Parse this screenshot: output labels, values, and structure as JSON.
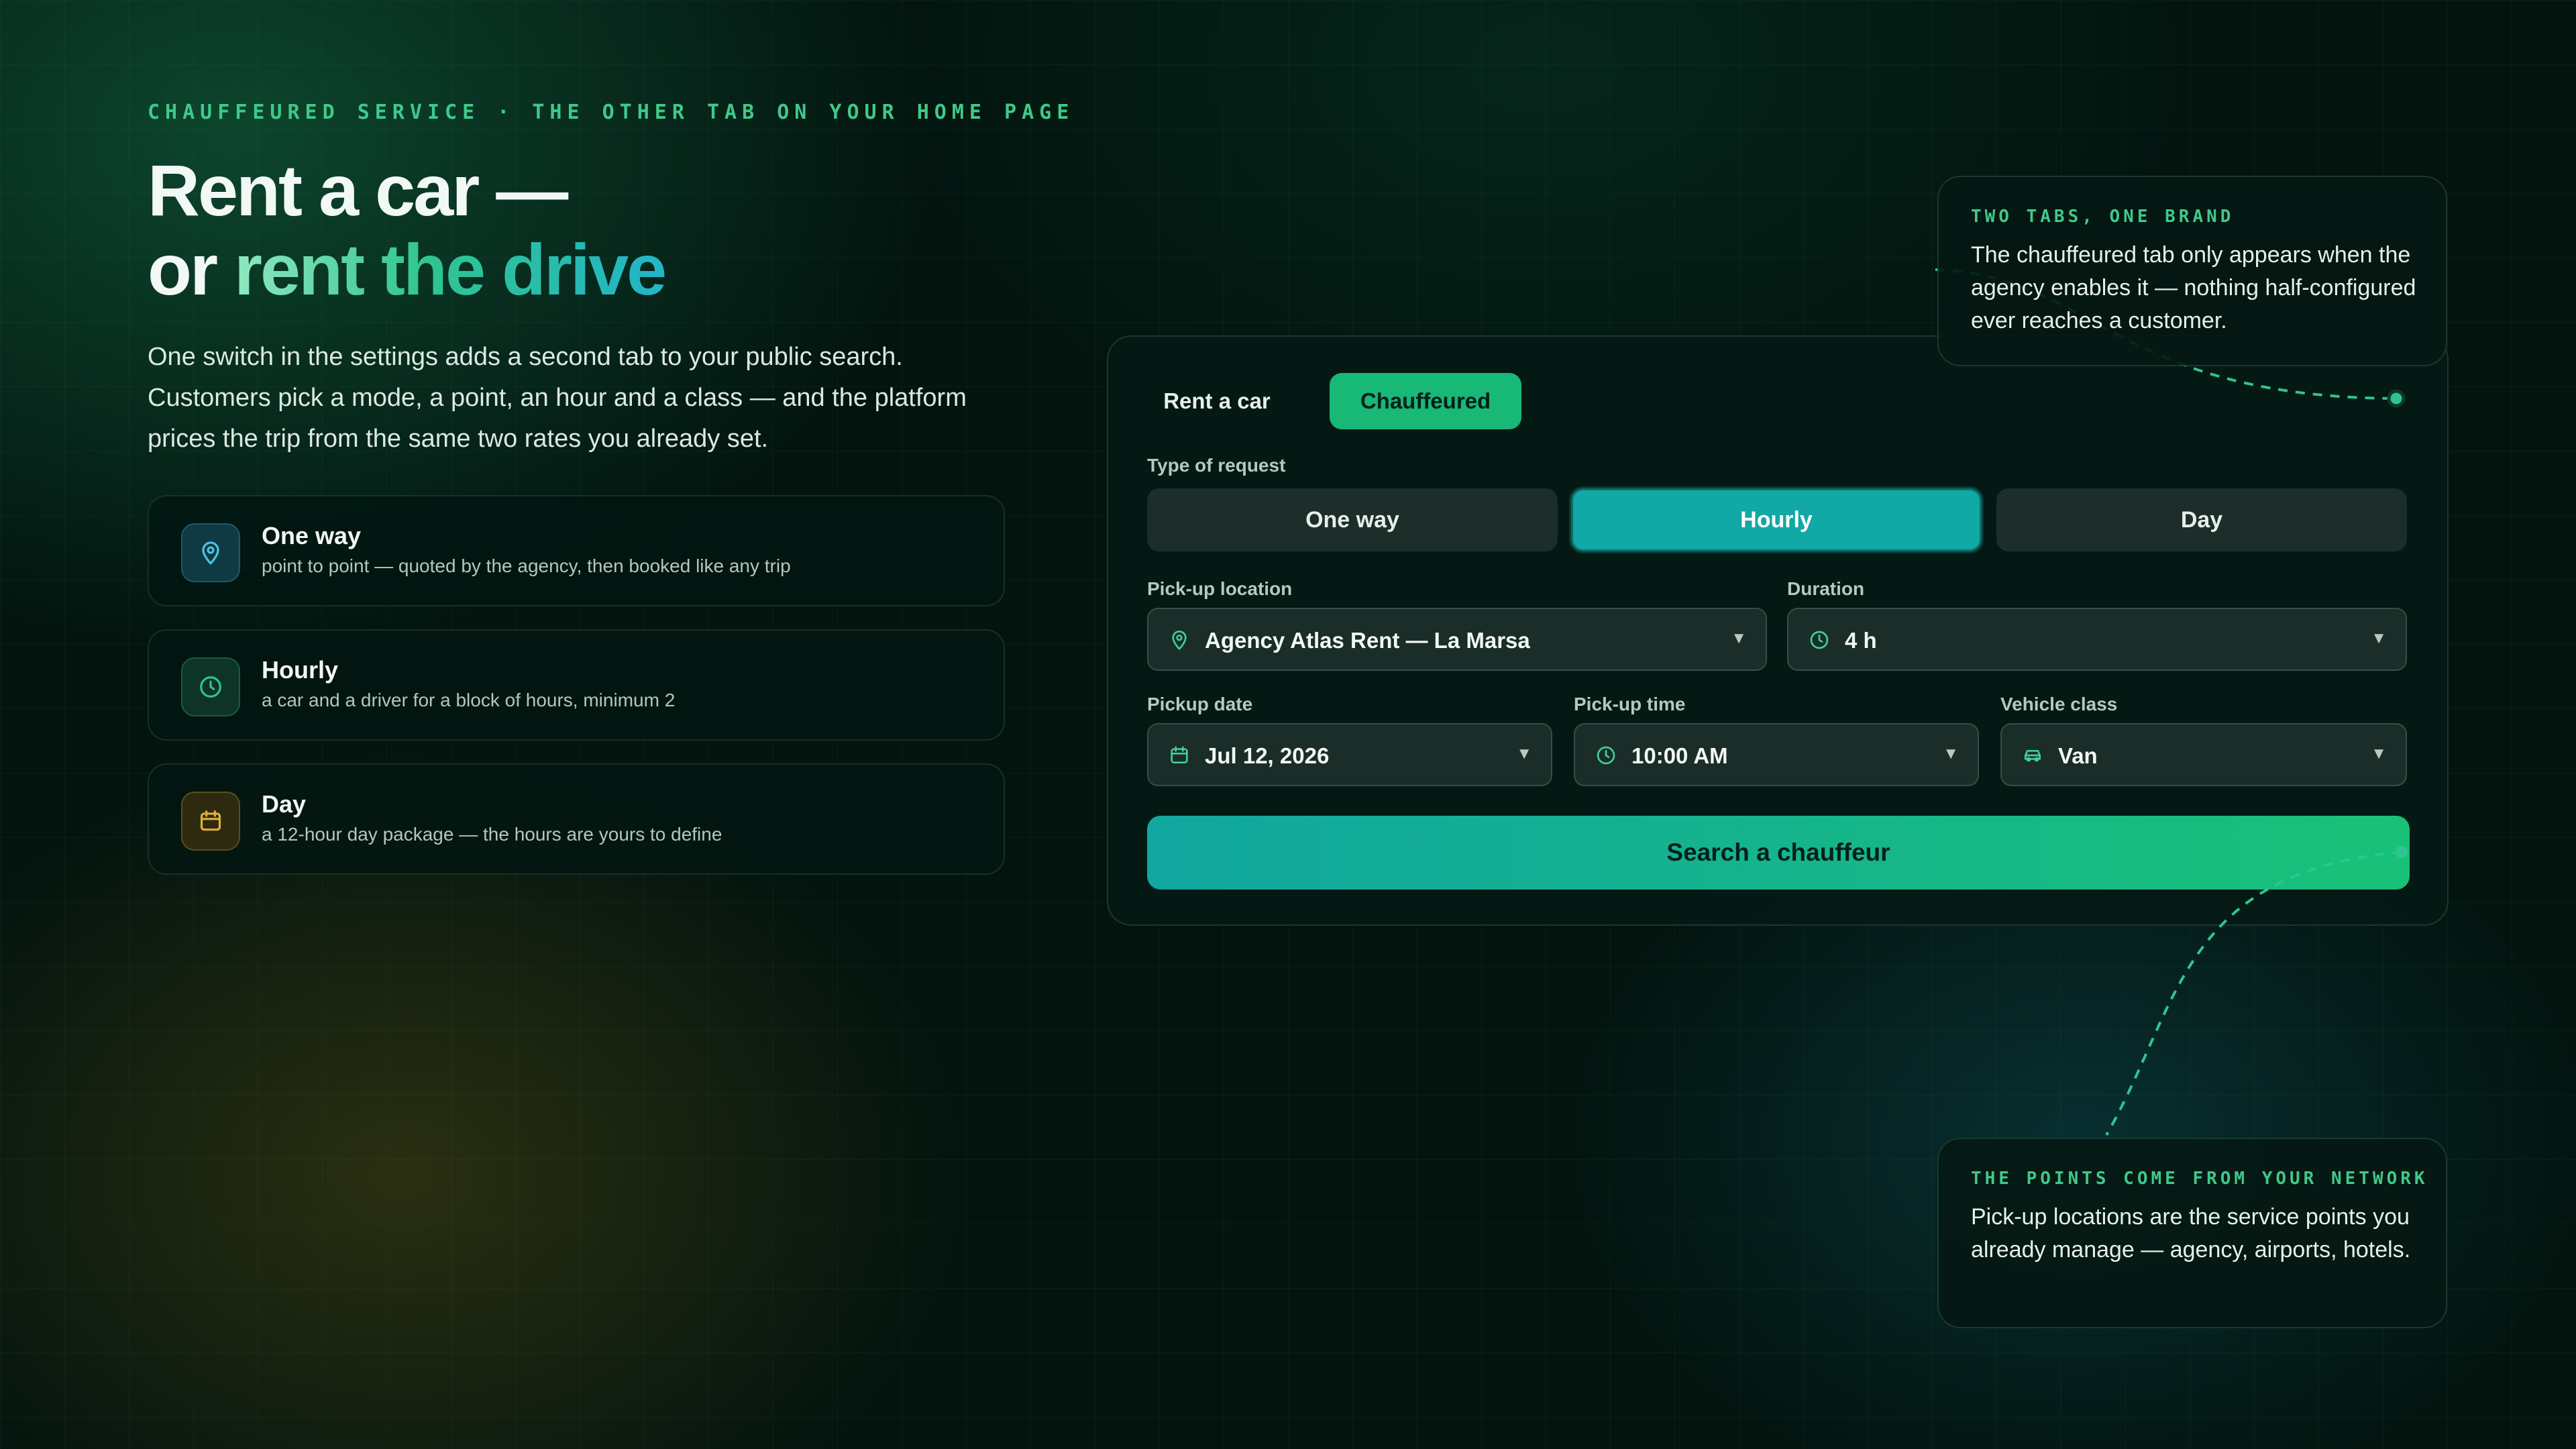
{
  "eyebrow": "CHAUFFEURED SERVICE · THE OTHER TAB ON YOUR HOME PAGE",
  "headline": {
    "line1": "Rent a car —",
    "line2_prefix": "or",
    "line2_accent": "rent the drive"
  },
  "lede": "One switch in the settings adds a second tab to your public search. Customers pick a mode, a point, an hour and a class — and the platform prices the trip from the same two rates you already set.",
  "features": [
    {
      "icon": "map-pin-icon",
      "title": "One way",
      "desc": "point to point — quoted by the agency, then booked like any trip"
    },
    {
      "icon": "clock-icon",
      "title": "Hourly",
      "desc": "a car and a driver for a block of hours, minimum 2"
    },
    {
      "icon": "calendar-icon",
      "title": "Day",
      "desc": "a 12-hour day package — the hours are yours to define"
    }
  ],
  "panel": {
    "tabs": [
      "Rent a car",
      "Chauffeured"
    ],
    "active_tab": "Chauffeured",
    "request_type_label": "Type of request",
    "request_types": [
      "One way",
      "Hourly",
      "Day"
    ],
    "active_request_type": "Hourly",
    "pickup_location": {
      "label": "Pick-up location",
      "value": "Agency Atlas Rent — La Marsa"
    },
    "duration": {
      "label": "Duration",
      "value": "4 h"
    },
    "pickup_date": {
      "label": "Pickup date",
      "value": "Jul 12, 2026"
    },
    "pickup_time": {
      "label": "Pick-up time",
      "value": "10:00 AM"
    },
    "vehicle_class": {
      "label": "Vehicle class",
      "value": "Van"
    },
    "search_button": "Search a chauffeur"
  },
  "callouts": {
    "top": {
      "heading": "TWO TABS, ONE BRAND",
      "body": "The chauffeured tab only appears when the agency enables it — nothing half-configured ever reaches a customer."
    },
    "bottom": {
      "heading": "THE POINTS COME FROM YOUR NETWORK",
      "body": "Pick-up locations are the service points you already manage — agency, airports, hotels."
    }
  },
  "colors": {
    "accent_green": "#18c178",
    "accent_teal": "#12a7a0",
    "eyebrow_green": "#3fc98a",
    "background": "#03140f"
  }
}
